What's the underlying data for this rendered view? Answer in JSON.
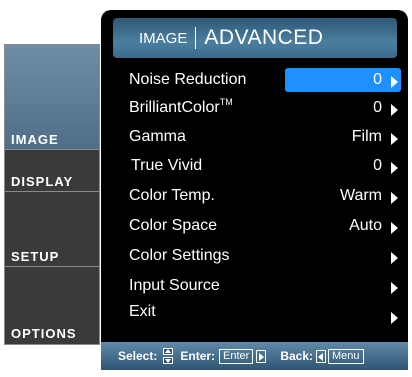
{
  "tabs": [
    {
      "label": "IMAGE",
      "active": true
    },
    {
      "label": "DISPLAY",
      "active": false
    },
    {
      "label": "SETUP",
      "active": false
    },
    {
      "label": "OPTIONS",
      "active": false
    }
  ],
  "header": {
    "section": "IMAGE",
    "title": "ADVANCED"
  },
  "menu": [
    {
      "label": "Noise Reduction",
      "value": "0",
      "selected": true
    },
    {
      "label": "BrilliantColor",
      "sup": "TM",
      "value": "0"
    },
    {
      "label": "Gamma",
      "value": "Film"
    },
    {
      "label": "True Vivid",
      "value": "0"
    },
    {
      "label": "Color Temp.",
      "value": "Warm"
    },
    {
      "label": "Color Space",
      "value": "Auto"
    },
    {
      "label": "Color Settings",
      "value": ""
    },
    {
      "label": "Input Source",
      "value": ""
    },
    {
      "label": "Exit",
      "value": ""
    }
  ],
  "footer": {
    "select_label": "Select:",
    "enter_label": "Enter:",
    "enter_key": "Enter",
    "back_label": "Back:",
    "menu_key": "Menu"
  },
  "colors": {
    "highlight": "#1e90ff",
    "header": "#4b7fa0",
    "background": "#000000"
  }
}
